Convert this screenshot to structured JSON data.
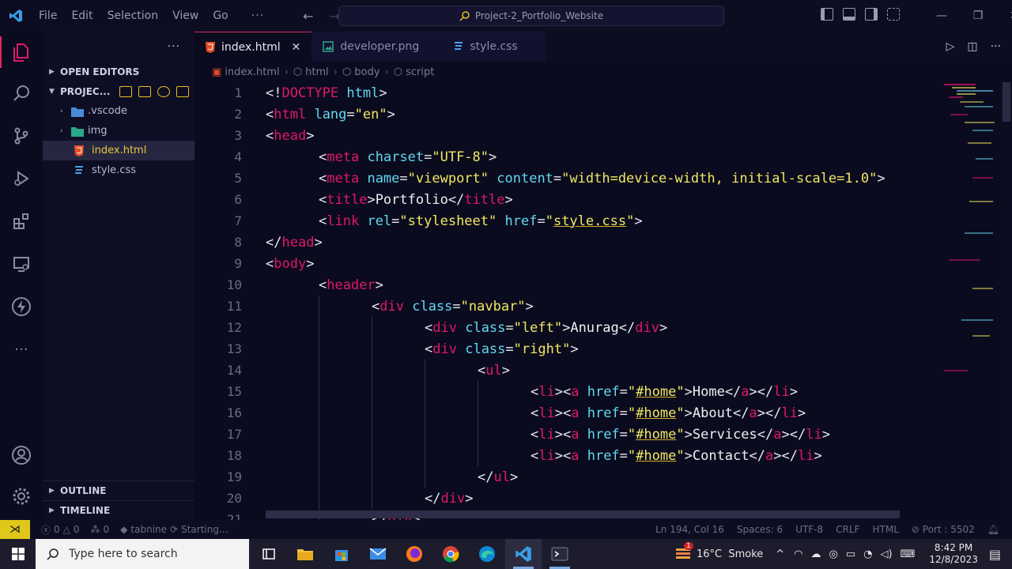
{
  "menu": [
    "File",
    "Edit",
    "Selection",
    "View",
    "Go",
    "···"
  ],
  "command_center": "Project-2_Portfolio_Website",
  "sidebar": {
    "header_dots": "···",
    "open_editors": "OPEN EDITORS",
    "project": "PROJEC...",
    "items": [
      {
        "label": ".vscode",
        "type": "folder"
      },
      {
        "label": "img",
        "type": "folder"
      },
      {
        "label": "index.html",
        "type": "html"
      },
      {
        "label": "style.css",
        "type": "css"
      }
    ],
    "outline": "OUTLINE",
    "timeline": "TIMELINE"
  },
  "tabs": [
    {
      "label": "index.html",
      "active": true
    },
    {
      "label": "developer.png",
      "active": false
    },
    {
      "label": "style.css",
      "active": false
    }
  ],
  "breadcrumb": [
    "index.html",
    "html",
    "body",
    "script"
  ],
  "code_lines": [
    {
      "n": "1",
      "indent": 0,
      "tokens": [
        [
          "p",
          "<!"
        ],
        [
          "doc",
          "DOCTYPE"
        ],
        [
          "p",
          " "
        ],
        [
          "html",
          "html"
        ],
        [
          "p",
          ">"
        ]
      ]
    },
    {
      "n": "2",
      "indent": 0,
      "tokens": [
        [
          "p",
          "<"
        ],
        [
          "tag",
          "html"
        ],
        [
          "p",
          " "
        ],
        [
          "attr",
          "lang"
        ],
        [
          "p",
          "="
        ],
        [
          "str",
          "\"en\""
        ],
        [
          "p",
          ">"
        ]
      ]
    },
    {
      "n": "3",
      "indent": 0,
      "tokens": [
        [
          "p",
          "<"
        ],
        [
          "tag",
          "head"
        ],
        [
          "p",
          ">"
        ]
      ]
    },
    {
      "n": "4",
      "indent": 1,
      "tokens": [
        [
          "p",
          "<"
        ],
        [
          "tag",
          "meta"
        ],
        [
          "p",
          " "
        ],
        [
          "attr",
          "charset"
        ],
        [
          "p",
          "="
        ],
        [
          "str",
          "\"UTF-8\""
        ],
        [
          "p",
          ">"
        ]
      ]
    },
    {
      "n": "5",
      "indent": 1,
      "tokens": [
        [
          "p",
          "<"
        ],
        [
          "tag",
          "meta"
        ],
        [
          "p",
          " "
        ],
        [
          "attr",
          "name"
        ],
        [
          "p",
          "="
        ],
        [
          "str",
          "\"viewport\""
        ],
        [
          "p",
          " "
        ],
        [
          "attr",
          "content"
        ],
        [
          "p",
          "="
        ],
        [
          "str",
          "\"width=device-width, initial-scale=1.0\""
        ],
        [
          "p",
          ">"
        ]
      ]
    },
    {
      "n": "6",
      "indent": 1,
      "tokens": [
        [
          "p",
          "<"
        ],
        [
          "tag",
          "title"
        ],
        [
          "p",
          ">"
        ],
        [
          "text",
          "Portfolio"
        ],
        [
          "p",
          "</"
        ],
        [
          "tag",
          "title"
        ],
        [
          "p",
          ">"
        ]
      ]
    },
    {
      "n": "7",
      "indent": 1,
      "tokens": [
        [
          "p",
          "<"
        ],
        [
          "tag",
          "link"
        ],
        [
          "p",
          " "
        ],
        [
          "attr",
          "rel"
        ],
        [
          "p",
          "="
        ],
        [
          "str",
          "\"stylesheet\""
        ],
        [
          "p",
          " "
        ],
        [
          "attr",
          "href"
        ],
        [
          "p",
          "="
        ],
        [
          "str",
          "\""
        ],
        [
          "link",
          "style.css"
        ],
        [
          "str",
          "\""
        ],
        [
          "p",
          ">"
        ]
      ]
    },
    {
      "n": "8",
      "indent": 0,
      "tokens": [
        [
          "p",
          "</"
        ],
        [
          "tag",
          "head"
        ],
        [
          "p",
          ">"
        ]
      ]
    },
    {
      "n": "9",
      "indent": 0,
      "tokens": [
        [
          "p",
          "<"
        ],
        [
          "tag",
          "body"
        ],
        [
          "p",
          ">"
        ]
      ]
    },
    {
      "n": "10",
      "indent": 1,
      "tokens": [
        [
          "p",
          "<"
        ],
        [
          "tag",
          "header"
        ],
        [
          "p",
          ">"
        ]
      ]
    },
    {
      "n": "11",
      "indent": 2,
      "tokens": [
        [
          "p",
          "<"
        ],
        [
          "tag",
          "div"
        ],
        [
          "p",
          " "
        ],
        [
          "attr",
          "class"
        ],
        [
          "p",
          "="
        ],
        [
          "str",
          "\"navbar\""
        ],
        [
          "p",
          ">"
        ]
      ]
    },
    {
      "n": "12",
      "indent": 3,
      "tokens": [
        [
          "p",
          "<"
        ],
        [
          "tag",
          "div"
        ],
        [
          "p",
          " "
        ],
        [
          "attr",
          "class"
        ],
        [
          "p",
          "="
        ],
        [
          "str",
          "\"left\""
        ],
        [
          "p",
          ">"
        ],
        [
          "text",
          "Anurag"
        ],
        [
          "p",
          "</"
        ],
        [
          "tag",
          "div"
        ],
        [
          "p",
          ">"
        ]
      ]
    },
    {
      "n": "13",
      "indent": 3,
      "tokens": [
        [
          "p",
          "<"
        ],
        [
          "tag",
          "div"
        ],
        [
          "p",
          " "
        ],
        [
          "attr",
          "class"
        ],
        [
          "p",
          "="
        ],
        [
          "str",
          "\"right\""
        ],
        [
          "p",
          ">"
        ]
      ]
    },
    {
      "n": "14",
      "indent": 4,
      "tokens": [
        [
          "p",
          "<"
        ],
        [
          "tag",
          "ul"
        ],
        [
          "p",
          ">"
        ]
      ]
    },
    {
      "n": "15",
      "indent": 5,
      "tokens": [
        [
          "p",
          "<"
        ],
        [
          "tag",
          "li"
        ],
        [
          "p",
          "><"
        ],
        [
          "tag",
          "a"
        ],
        [
          "p",
          " "
        ],
        [
          "attr",
          "href"
        ],
        [
          "p",
          "="
        ],
        [
          "str",
          "\""
        ],
        [
          "link",
          "#home"
        ],
        [
          "str",
          "\""
        ],
        [
          "p",
          ">"
        ],
        [
          "text",
          "Home"
        ],
        [
          "p",
          "</"
        ],
        [
          "tag",
          "a"
        ],
        [
          "p",
          "></"
        ],
        [
          "tag",
          "li"
        ],
        [
          "p",
          ">"
        ]
      ]
    },
    {
      "n": "16",
      "indent": 5,
      "tokens": [
        [
          "p",
          "<"
        ],
        [
          "tag",
          "li"
        ],
        [
          "p",
          "><"
        ],
        [
          "tag",
          "a"
        ],
        [
          "p",
          " "
        ],
        [
          "attr",
          "href"
        ],
        [
          "p",
          "="
        ],
        [
          "str",
          "\""
        ],
        [
          "link",
          "#home"
        ],
        [
          "str",
          "\""
        ],
        [
          "p",
          ">"
        ],
        [
          "text",
          "About"
        ],
        [
          "p",
          "</"
        ],
        [
          "tag",
          "a"
        ],
        [
          "p",
          "></"
        ],
        [
          "tag",
          "li"
        ],
        [
          "p",
          ">"
        ]
      ]
    },
    {
      "n": "17",
      "indent": 5,
      "tokens": [
        [
          "p",
          "<"
        ],
        [
          "tag",
          "li"
        ],
        [
          "p",
          "><"
        ],
        [
          "tag",
          "a"
        ],
        [
          "p",
          " "
        ],
        [
          "attr",
          "href"
        ],
        [
          "p",
          "="
        ],
        [
          "str",
          "\""
        ],
        [
          "link",
          "#home"
        ],
        [
          "str",
          "\""
        ],
        [
          "p",
          ">"
        ],
        [
          "text",
          "Services"
        ],
        [
          "p",
          "</"
        ],
        [
          "tag",
          "a"
        ],
        [
          "p",
          "></"
        ],
        [
          "tag",
          "li"
        ],
        [
          "p",
          ">"
        ]
      ]
    },
    {
      "n": "18",
      "indent": 5,
      "tokens": [
        [
          "p",
          "<"
        ],
        [
          "tag",
          "li"
        ],
        [
          "p",
          "><"
        ],
        [
          "tag",
          "a"
        ],
        [
          "p",
          " "
        ],
        [
          "attr",
          "href"
        ],
        [
          "p",
          "="
        ],
        [
          "str",
          "\""
        ],
        [
          "link",
          "#home"
        ],
        [
          "str",
          "\""
        ],
        [
          "p",
          ">"
        ],
        [
          "text",
          "Contact"
        ],
        [
          "p",
          "</"
        ],
        [
          "tag",
          "a"
        ],
        [
          "p",
          "></"
        ],
        [
          "tag",
          "li"
        ],
        [
          "p",
          ">"
        ]
      ]
    },
    {
      "n": "19",
      "indent": 4,
      "tokens": [
        [
          "p",
          "</"
        ],
        [
          "tag",
          "ul"
        ],
        [
          "p",
          ">"
        ]
      ]
    },
    {
      "n": "20",
      "indent": 3,
      "tokens": [
        [
          "p",
          "</"
        ],
        [
          "tag",
          "div"
        ],
        [
          "p",
          ">"
        ]
      ]
    },
    {
      "n": "21",
      "indent": 2,
      "tokens": [
        [
          "p",
          "</"
        ],
        [
          "tag",
          "div"
        ],
        [
          "p",
          ">"
        ]
      ]
    }
  ],
  "status": {
    "errors": "0",
    "warnings": "0",
    "ports": "0",
    "tabnine": "tabnine",
    "starting": "Starting...",
    "position": "Ln 194, Col 16",
    "spaces": "Spaces: 6",
    "encoding": "UTF-8",
    "eol": "CRLF",
    "language": "HTML",
    "port": "Port : 5502"
  },
  "taskbar": {
    "search_placeholder": "Type here to search",
    "weather": "16°C  Smoke",
    "weather_badge": "1",
    "time": "8:42 PM",
    "date": "12/8/2023"
  },
  "colors": {
    "accent": "#e02a5a",
    "tag": "#e0186a",
    "attr": "#60d8f0",
    "string": "#f0e860",
    "remote": "#e0c81a"
  }
}
